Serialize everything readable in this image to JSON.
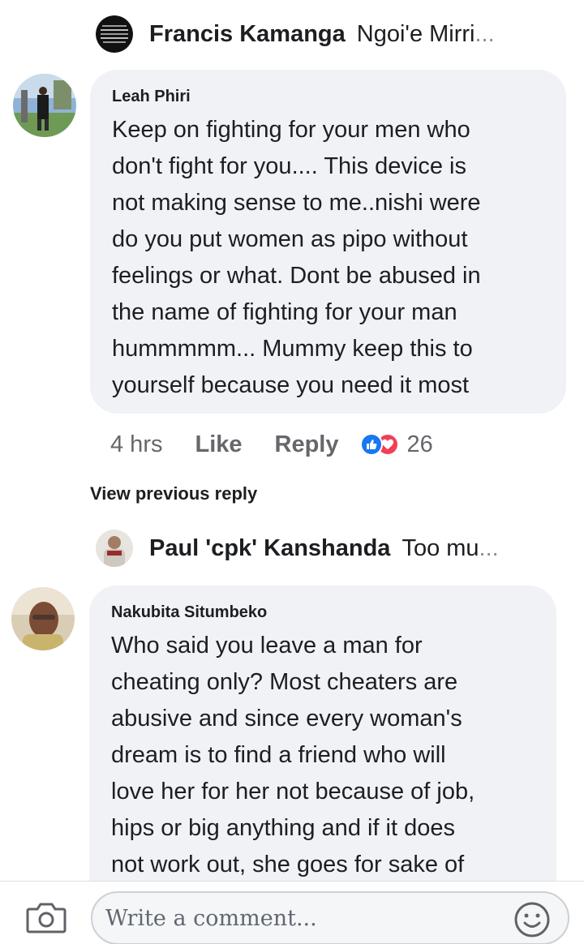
{
  "reply_francis": {
    "name": "Francis Kamanga",
    "snippet": "Ngoi'e Mirri",
    "ellipsis": "..."
  },
  "comment_leah": {
    "author": "Leah Phiri",
    "text": "Keep on fighting for your men who\ndon't fight for you.... This device is\nnot making sense to me..nishi were\ndo you put women as pipo without\nfeelings or what. Dont be abused in\nthe name of fighting for your man\nhummmmm... Mummy keep this to\nyourself because you need it most",
    "time": "4 hrs",
    "like_label": "Like",
    "reply_label": "Reply",
    "reaction_count": "26"
  },
  "view_previous_reply": "View previous reply",
  "reply_paul": {
    "name": "Paul 'cpk' Kanshanda",
    "snippet": "Too mu",
    "ellipsis": "..."
  },
  "comment_nakubita": {
    "author": "Nakubita Situmbeko",
    "text": "Who said you leave a man for\ncheating only? Most cheaters are\nabusive and since every woman's\ndream is to find a friend who will\nlove her for her not because of job,\nhips or big anything and if it does\nnot work out, she goes for sake of"
  },
  "composer": {
    "placeholder": "Write a comment..."
  },
  "colors": {
    "bubble_bg": "#f0f2f5",
    "like_blue": "#1877f2",
    "love_red": "#f33e58",
    "muted_text": "#65676b"
  },
  "icons": [
    "camera-icon",
    "smiley-icon",
    "like-reaction-icon",
    "love-reaction-icon"
  ]
}
